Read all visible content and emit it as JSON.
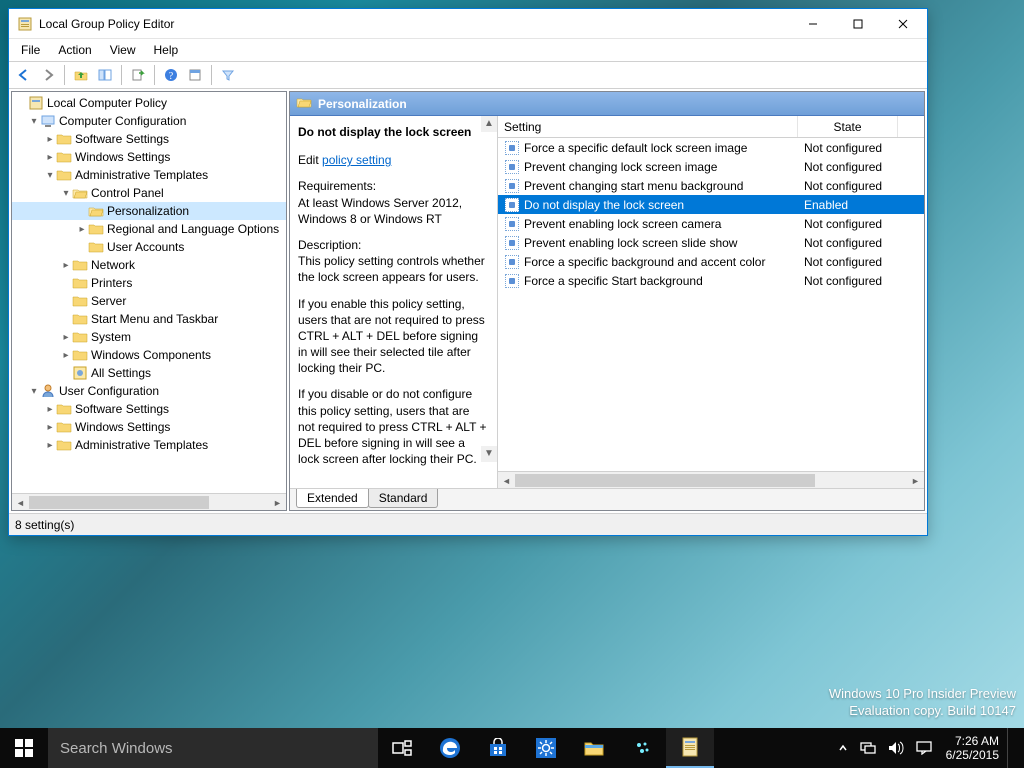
{
  "window": {
    "title": "Local Group Policy Editor",
    "menu": [
      "File",
      "Action",
      "View",
      "Help"
    ]
  },
  "tree": {
    "root": "Local Computer Policy",
    "cc": "Computer Configuration",
    "cc_children": {
      "sw": "Software Settings",
      "ws": "Windows Settings",
      "at": "Administrative Templates",
      "cp": "Control Panel",
      "pers": "Personalization",
      "rlo": "Regional and Language Options",
      "ua": "User Accounts",
      "net": "Network",
      "prn": "Printers",
      "srv": "Server",
      "smt": "Start Menu and Taskbar",
      "sys": "System",
      "wc": "Windows Components",
      "all": "All Settings"
    },
    "uc": "User Configuration",
    "uc_children": {
      "sw": "Software Settings",
      "ws": "Windows Settings",
      "at": "Administrative Templates"
    }
  },
  "details": {
    "header": "Personalization",
    "selected_title": "Do not display the lock screen",
    "edit_prefix": "Edit ",
    "edit_link": "policy setting",
    "req_label": "Requirements:",
    "req_text": "At least Windows Server 2012, Windows 8 or Windows RT",
    "desc_label": "Description:",
    "desc_1": "This policy setting controls whether the lock screen appears for users.",
    "desc_2": "If you enable this policy setting, users that are not required to press CTRL + ALT + DEL before signing in will see their selected tile after locking their PC.",
    "desc_3": "If you disable or do not configure this policy setting, users that are not required to press CTRL + ALT + DEL before signing in will see a lock screen after locking their PC."
  },
  "list": {
    "col_setting": "Setting",
    "col_state": "State",
    "rows": [
      {
        "name": "Force a specific default lock screen image",
        "state": "Not configured",
        "selected": false
      },
      {
        "name": "Prevent changing lock screen image",
        "state": "Not configured",
        "selected": false
      },
      {
        "name": "Prevent changing start menu background",
        "state": "Not configured",
        "selected": false
      },
      {
        "name": "Do not display the lock screen",
        "state": "Enabled",
        "selected": true
      },
      {
        "name": "Prevent enabling lock screen camera",
        "state": "Not configured",
        "selected": false
      },
      {
        "name": "Prevent enabling lock screen slide show",
        "state": "Not configured",
        "selected": false
      },
      {
        "name": "Force a specific background and accent color",
        "state": "Not configured",
        "selected": false
      },
      {
        "name": "Force a specific Start background",
        "state": "Not configured",
        "selected": false
      }
    ]
  },
  "tabs": {
    "extended": "Extended",
    "standard": "Standard"
  },
  "status": "8 setting(s)",
  "taskbar": {
    "search_placeholder": "Search Windows"
  },
  "desktop_info": {
    "l1": "Windows 10 Pro Insider Preview",
    "l2": "Evaluation copy. Build 10147"
  },
  "clock": {
    "time": "7:26 AM",
    "date": "6/25/2015"
  }
}
